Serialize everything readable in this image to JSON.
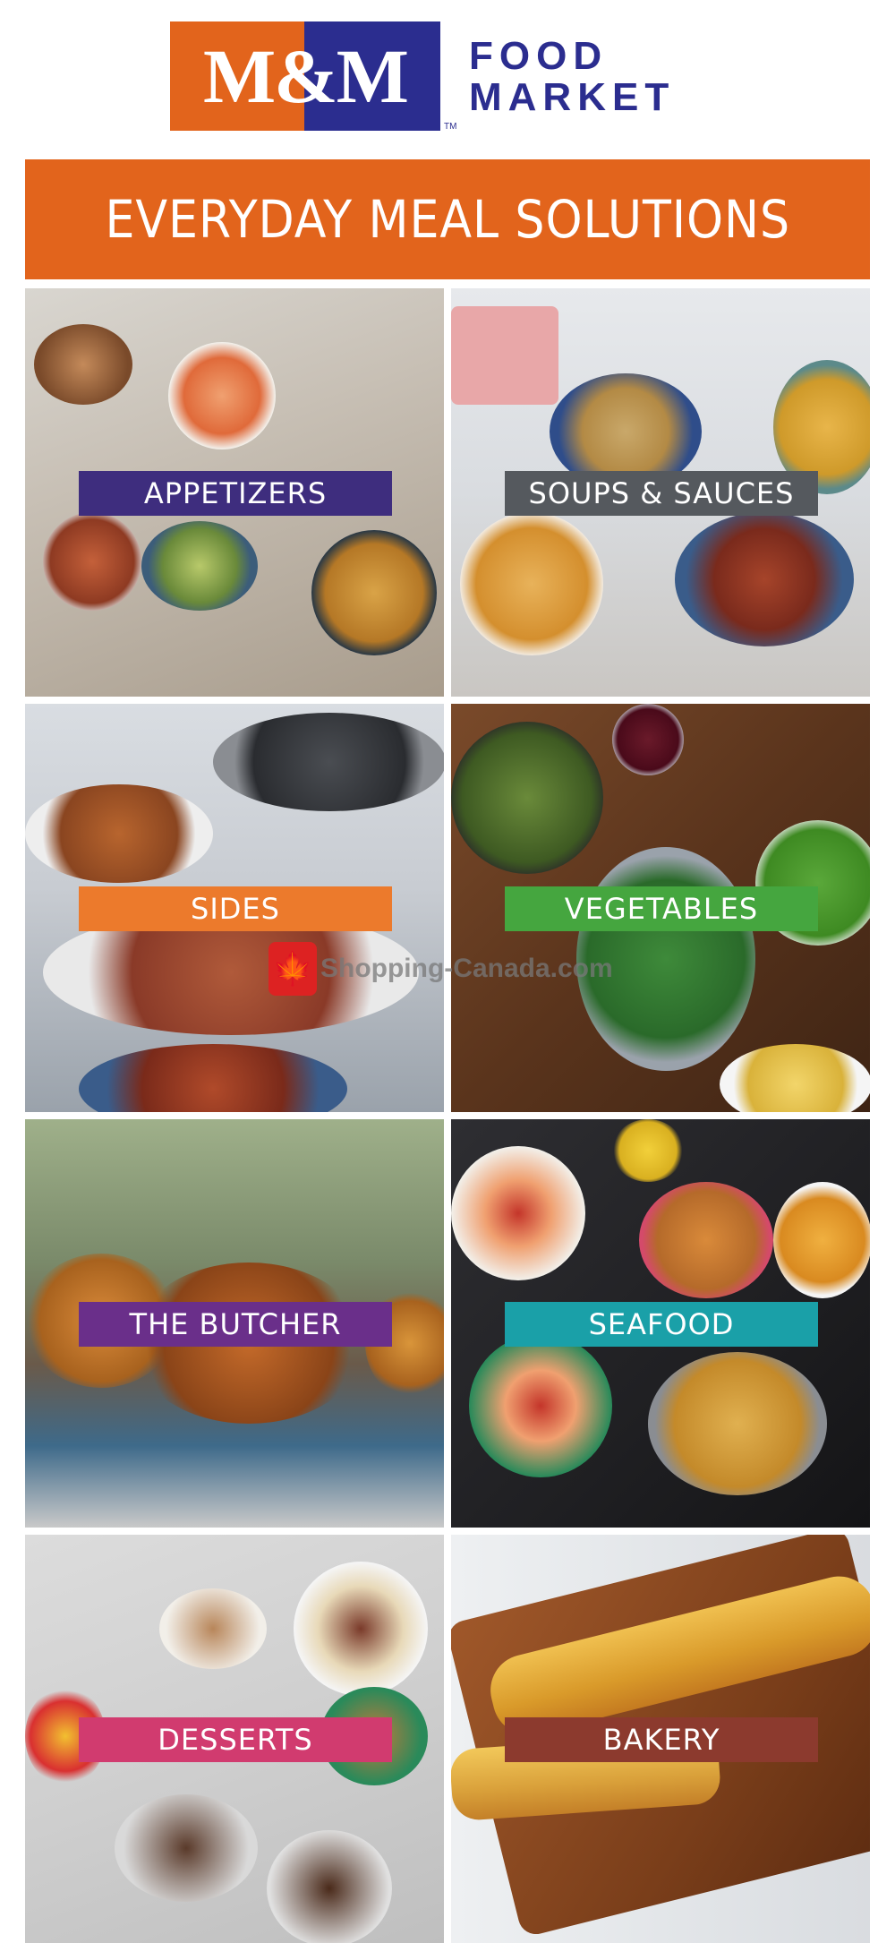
{
  "header": {
    "logo_text": "M&M",
    "logo_tm": "TM",
    "logo_sub_line1": "FOOD",
    "logo_sub_line2": "MARKET",
    "colors": {
      "orange": "#e2641c",
      "navy": "#2b2d8f"
    }
  },
  "banner": {
    "title": "EVERYDAY MEAL SOLUTIONS"
  },
  "categories": [
    {
      "label": "APPETIZERS",
      "label_color": "#3e2d7e"
    },
    {
      "label": "SOUPS & SAUCES",
      "label_color": "#55595e"
    },
    {
      "label": "SIDES",
      "label_color": "#ec7a2c"
    },
    {
      "label": "VEGETABLES",
      "label_color": "#45a63f"
    },
    {
      "label": "THE BUTCHER",
      "label_color": "#6a2f8a"
    },
    {
      "label": "SEAFOOD",
      "label_color": "#1aa0a8"
    },
    {
      "label": "DESSERTS",
      "label_color": "#d13b6f"
    },
    {
      "label": "BAKERY",
      "label_color": "#8c3a2e"
    }
  ],
  "watermark": {
    "icon": "maple-leaf-icon",
    "text": "Shopping-Canada.com"
  }
}
